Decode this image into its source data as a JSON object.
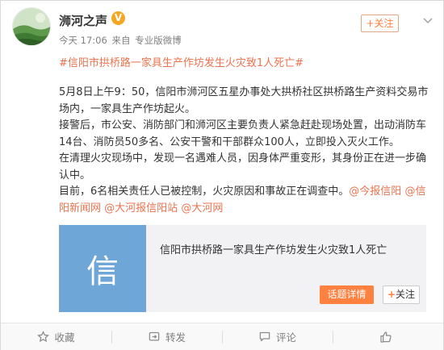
{
  "header": {
    "user_name": "浉河之声",
    "verified_badge": "V",
    "time": "今天 17:06",
    "source_prefix": "来自",
    "source": "专业版微博",
    "follow_label": "+关注"
  },
  "post": {
    "topic": "#信阳市拱桥路一家具生产作坊发生火灾致1人死亡#",
    "p1": "5月8日上午9：50，信阳市浉河区五星办事处大拱桥社区拱桥路生产资料交易市场内，一家具生产作坊起火。",
    "p2": "接警后，市公安、消防部门和浉河区主要负责人紧急赶赴现场处置，出动消防车14台、消防员50多名、公安干警和干部群众100人，立即投入灭火工作。",
    "p3": "在清理火灾现场中，发现一名遇难人员，因身体严重变形，其身份正在进一步确认中。",
    "p4_text": "目前，6名相关责任人已被控制，火灾原因和事故正在调查中。",
    "mentions": [
      "@今报信阳",
      "@信阳新闻网",
      "@大河报信阳站",
      "@大河网"
    ]
  },
  "link_card": {
    "thumb_char": "信",
    "title": "信阳市拱桥路一家具生产作坊发生火灾致1人死亡",
    "detail_label": "话题详情",
    "follow_label": "关注"
  },
  "footer": {
    "favorite": "收藏",
    "repost": "转发",
    "comment": "评论",
    "like_icon": "thumbs-up-icon"
  },
  "colors": {
    "accent": "#eb7350",
    "button_orange": "#ff8140",
    "verified": "#f5a623",
    "thumb": "#6fa6d8"
  }
}
